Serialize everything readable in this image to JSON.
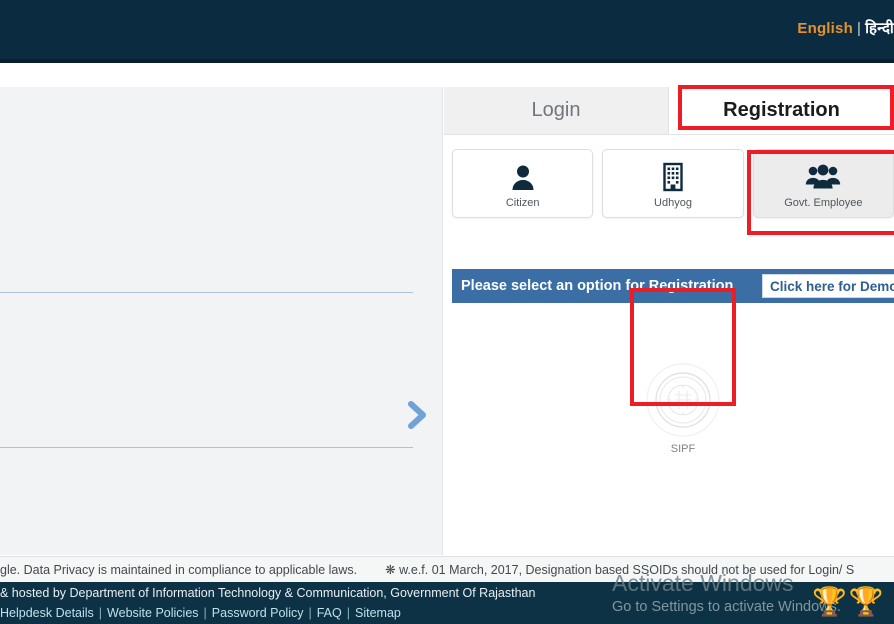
{
  "header": {
    "language": {
      "english": "English",
      "separator": "|",
      "hindi": "हिन्दी"
    }
  },
  "tabs": [
    {
      "label": "Login",
      "active": false
    },
    {
      "label": "Registration",
      "active": true
    }
  ],
  "categories": [
    {
      "label": "Citizen",
      "icon": "person-icon",
      "selected": false
    },
    {
      "label": "Udhyog",
      "icon": "building-icon",
      "selected": false
    },
    {
      "label": "Govt. Employee",
      "icon": "people-group-icon",
      "selected": true
    }
  ],
  "option_bar": {
    "prompt": "Please select an option for Registration",
    "demo_button": "Click here for Demo"
  },
  "registration_options": [
    {
      "label": "SIPF",
      "icon": "sipf-emblem-icon",
      "highlighted": true
    }
  ],
  "notice": {
    "privacy": "gle. Data Privacy is maintained in compliance to applicable laws.",
    "advisory": "❋ w.e.f. 01 March, 2017, Designation based SSOIDs should not be used for Login/ S"
  },
  "footer": {
    "line1": "& hosted by Department of Information Technology & Communication, Government Of Rajasthan",
    "links": [
      "Helpdesk Details",
      "Website Policies",
      "Password Policy",
      "FAQ",
      "Sitemap"
    ],
    "separator": "|"
  },
  "watermark": {
    "line1": "Activate Windows",
    "line2": "Go to Settings to activate Windows."
  },
  "trophies": "🏆🏆",
  "colors": {
    "header_navy": "#0a2b40",
    "footer_navy": "#0d3246",
    "accent_orange": "#e8912a",
    "option_bar_blue": "#3a6ea5",
    "highlight_red": "#ee1c25",
    "chevron_blue": "#6fa2d6",
    "panel_gray": "#f2f3f4"
  }
}
